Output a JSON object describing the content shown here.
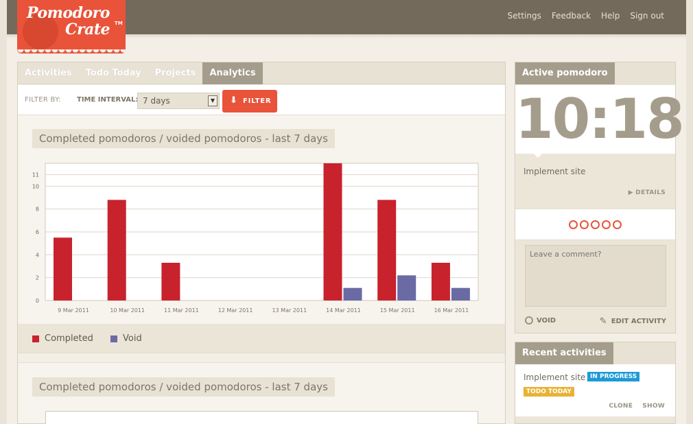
{
  "brand": {
    "line1": "Pomodoro",
    "line2": "Crate",
    "tm": "TM"
  },
  "topnav": [
    "Settings",
    "Feedback",
    "Help",
    "Sign out"
  ],
  "tabs": [
    {
      "label": "Activities",
      "active": false
    },
    {
      "label": "Todo Today",
      "active": false
    },
    {
      "label": "Projects",
      "active": false
    },
    {
      "label": "Analytics",
      "active": true
    }
  ],
  "filter": {
    "filter_by": "FILTER BY:",
    "time_interval": "TIME INTERVAL:",
    "selected": "7 days",
    "button": "FILTER"
  },
  "charts": [
    {
      "title": "Completed pomodoros / voided pomodoros - last 7 days"
    },
    {
      "title": "Completed pomodoros / voided pomodoros - last 7 days"
    }
  ],
  "chart_data": {
    "type": "bar",
    "categories": [
      "9 Mar 2011",
      "10 Mar 2011",
      "11 Mar 2011",
      "12 Mar 2011",
      "13 Mar 2011",
      "14 Mar 2011",
      "15 Mar 2011",
      "16 Mar 2011"
    ],
    "series": [
      {
        "name": "Completed",
        "color": "#c8222d",
        "values": [
          5.5,
          8.8,
          3.3,
          0,
          0,
          12,
          8.8,
          3.3
        ]
      },
      {
        "name": "Void",
        "color": "#6a6aa4",
        "values": [
          0,
          0,
          0,
          0,
          0,
          1.1,
          2.2,
          1.1
        ]
      }
    ],
    "yticks": [
      "0",
      "2",
      "4",
      "6",
      "8",
      "10",
      "11"
    ],
    "ylim": [
      0,
      12
    ],
    "grid": true,
    "legend": "bottom-left"
  },
  "active_pomodoro": {
    "header": "Active pomodoro",
    "time": "10:18",
    "activity": "Implement site",
    "details": "▶ DETAILS",
    "pomodoro_count": 5,
    "comment_placeholder": "Leave a comment?",
    "void": "VOID",
    "edit": "EDIT ACTIVITY"
  },
  "recent": {
    "header": "Recent activities",
    "items": [
      {
        "name": "Implement site",
        "status": "IN PROGRESS",
        "tag": "TODO TODAY",
        "clone": "CLONE",
        "show": "SHOW"
      }
    ]
  },
  "colors": {
    "accent": "#e8533a",
    "topbar": "#736a5c",
    "completed": "#c8222d",
    "void": "#6a6aa4"
  }
}
